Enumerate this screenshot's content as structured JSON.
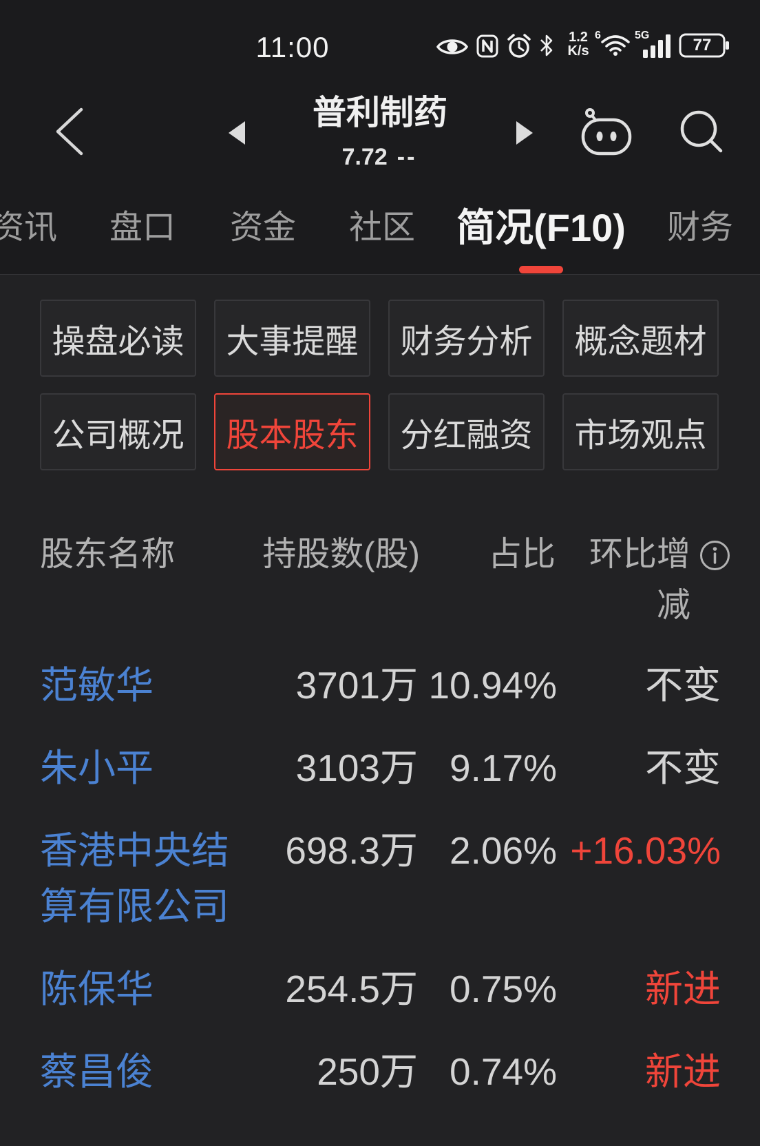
{
  "colors": {
    "header_bg": "#1b1b1d",
    "content_bg": "#222224",
    "accent_red": "#f0453a",
    "link_blue": "#4b82d2"
  },
  "status_bar": {
    "time": "11:00",
    "net_speed_value": "1.2",
    "net_speed_unit": "K/s",
    "wifi_badge": "6",
    "network_type": "5G",
    "battery_level": "77",
    "icons": {
      "eye": "eye-icon",
      "nfc": "nfc-icon",
      "alarm": "alarm-icon",
      "bluetooth": "bluetooth-icon",
      "wifi": "wifi-icon",
      "signal": "signal-icon",
      "battery": "battery-icon"
    }
  },
  "header": {
    "title": "普利制药",
    "price": "7.72",
    "change": "--",
    "icons": {
      "back": "chevron-left-icon",
      "prev": "triangle-left-icon",
      "next": "triangle-right-icon",
      "assistant": "robot-icon",
      "search": "search-icon"
    }
  },
  "tabs": [
    {
      "label": "资讯",
      "active": false
    },
    {
      "label": "盘口",
      "active": false
    },
    {
      "label": "资金",
      "active": false
    },
    {
      "label": "社区",
      "active": false
    },
    {
      "label": "简况(F10)",
      "active": true
    },
    {
      "label": "财务",
      "active": false
    }
  ],
  "subnav": [
    {
      "label": "操盘必读",
      "selected": false
    },
    {
      "label": "大事提醒",
      "selected": false
    },
    {
      "label": "财务分析",
      "selected": false
    },
    {
      "label": "概念题材",
      "selected": false
    },
    {
      "label": "公司概况",
      "selected": false
    },
    {
      "label": "股本股东",
      "selected": true
    },
    {
      "label": "分红融资",
      "selected": false
    },
    {
      "label": "市场观点",
      "selected": false
    }
  ],
  "table": {
    "columns": {
      "name": "股东名称",
      "shares": "持股数(股)",
      "ratio": "占比",
      "change": "环比增减"
    },
    "info_icon": "info-icon",
    "rows": [
      {
        "name": "范敏华",
        "shares": "3701万",
        "ratio": "10.94%",
        "change": "不变",
        "change_color": "#d4d4d4"
      },
      {
        "name": "朱小平",
        "shares": "3103万",
        "ratio": "9.17%",
        "change": "不变",
        "change_color": "#d4d4d4"
      },
      {
        "name": "香港中央结算有限公司",
        "shares": "698.3万",
        "ratio": "2.06%",
        "change": "+16.03%",
        "change_color": "#f0453a"
      },
      {
        "name": "陈保华",
        "shares": "254.5万",
        "ratio": "0.75%",
        "change": "新进",
        "change_color": "#f0453a"
      },
      {
        "name": "蔡昌俊",
        "shares": "250万",
        "ratio": "0.74%",
        "change": "新进",
        "change_color": "#f0453a"
      }
    ]
  }
}
